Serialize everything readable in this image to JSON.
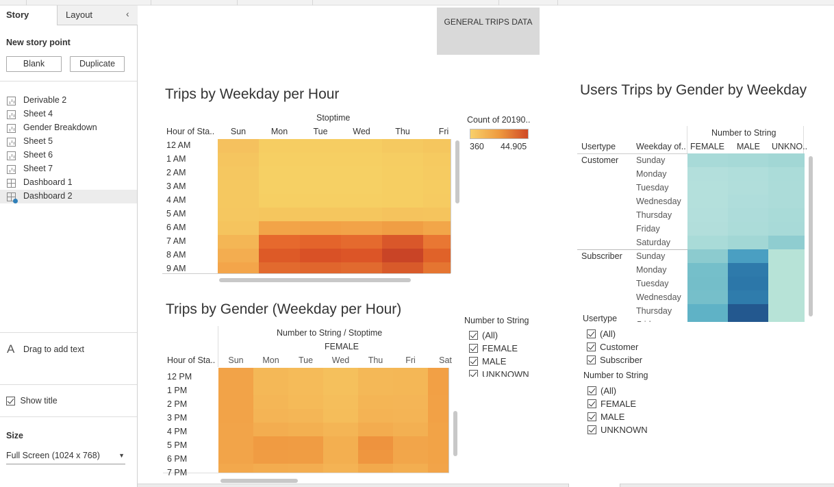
{
  "left_panel": {
    "tabs": {
      "story": "Story",
      "layout": "Layout"
    },
    "new_story_point": "New story point",
    "blank_button": "Blank",
    "duplicate_button": "Duplicate",
    "sheets": [
      {
        "label": "Derivable 2",
        "icon": "sheet-icon"
      },
      {
        "label": "Sheet 4",
        "icon": "sheet-icon"
      },
      {
        "label": "Gender Breakdown",
        "icon": "sheet-icon"
      },
      {
        "label": "Sheet 5",
        "icon": "sheet-icon"
      },
      {
        "label": "Sheet 6",
        "icon": "sheet-icon"
      },
      {
        "label": "Sheet 7",
        "icon": "sheet-icon"
      },
      {
        "label": "Dashboard 1",
        "icon": "dashboard-icon"
      },
      {
        "label": "Dashboard 2",
        "icon": "dashboard-selected-icon"
      }
    ],
    "drag_text": "Drag to add text",
    "show_title": "Show title",
    "size_label": "Size",
    "size_value": "Full Screen (1024 x 768)"
  },
  "dashboard": {
    "header_button": "GENERAL TRIPS DATA",
    "chart1": {
      "title": "Trips by Weekday per Hour",
      "column_header": "Stoptime",
      "row_header": "Hour of Sta..",
      "columns": [
        "Sun",
        "Mon",
        "Tue",
        "Wed",
        "Thu",
        "Fri"
      ],
      "rows": [
        "12 AM",
        "1 AM",
        "2 AM",
        "3 AM",
        "4 AM",
        "5 AM",
        "6 AM",
        "7 AM",
        "8 AM",
        "9 AM"
      ],
      "legend_title": "Count of 20190..",
      "legend_min": "360",
      "legend_max": "44.905",
      "colors": [
        [
          "#f5c15e",
          "#f6cd62",
          "#f6cd62",
          "#f6cd62",
          "#f5c960",
          "#f5c65e"
        ],
        [
          "#f5c55f",
          "#f6cf63",
          "#f6cf63",
          "#f6cf63",
          "#f6cd62",
          "#f6ca60"
        ],
        [
          "#f5c760",
          "#f6d064",
          "#f6d064",
          "#f6d064",
          "#f6ce62",
          "#f6cb61"
        ],
        [
          "#f5c860",
          "#f6d064",
          "#f6d064",
          "#f6d064",
          "#f6ce62",
          "#f6cc61"
        ],
        [
          "#f5c860",
          "#f6cf63",
          "#f6cf63",
          "#f6cf63",
          "#f6ce62",
          "#f6cb61"
        ],
        [
          "#f5c760",
          "#f5c65e",
          "#f5c65e",
          "#f5c65e",
          "#f5c35d",
          "#f5c45d"
        ],
        [
          "#f5c45e",
          "#f2a448",
          "#f2a146",
          "#f2a348",
          "#f09e44",
          "#f2a649"
        ],
        [
          "#f4b655",
          "#e6692d",
          "#e4642b",
          "#e56a2e",
          "#d9572a",
          "#e97733"
        ],
        [
          "#f3ad50",
          "#dd5a27",
          "#d95126",
          "#dc5527",
          "#c94426",
          "#e06229"
        ],
        [
          "#f3a54a",
          "#e26a2e",
          "#e0662d",
          "#e16a2f",
          "#d85a2a",
          "#e57531"
        ]
      ]
    },
    "chart2": {
      "title": "Trips by Gender (Weekday per Hour)",
      "column_header": "Number to String  /  Stoptime",
      "subheader": "FEMALE",
      "row_header": "Hour of Sta..",
      "columns": [
        "Sun",
        "Mon",
        "Tue",
        "Wed",
        "Thu",
        "Fri",
        "Sat"
      ],
      "rows": [
        "12 PM",
        "1 PM",
        "2 PM",
        "3 PM",
        "4 PM",
        "5 PM",
        "6 PM",
        "7 PM"
      ],
      "colors": [
        [
          "#f2a348",
          "#f4b857",
          "#f5bb59",
          "#f5c05c",
          "#f4b857",
          "#f4b756",
          "#f2a045"
        ],
        [
          "#f2a348",
          "#f4b857",
          "#f5bb59",
          "#f5c05c",
          "#f4b857",
          "#f4b756",
          "#f2a045"
        ],
        [
          "#f2a348",
          "#f4b656",
          "#f5ba58",
          "#f5be5b",
          "#f4b555",
          "#f4b556",
          "#f2a146"
        ],
        [
          "#f2a348",
          "#f4b455",
          "#f4b656",
          "#f5bd5a",
          "#f4b354",
          "#f4b455",
          "#f2a146"
        ],
        [
          "#f2a449",
          "#f3ad50",
          "#f3b051",
          "#f4b555",
          "#f3ac4f",
          "#f3b052",
          "#f2a347"
        ],
        [
          "#f2a449",
          "#f09b42",
          "#f09c43",
          "#f3af50",
          "#ee933e",
          "#f2a54a",
          "#f2a347"
        ],
        [
          "#f2a449",
          "#f09c43",
          "#f09d43",
          "#f3af50",
          "#ef963f",
          "#f2a64a",
          "#f2a347"
        ],
        [
          "#f3a84c",
          "#f3ac4f",
          "#f3ad50",
          "#f4b354",
          "#f2a94c",
          "#f3ae50",
          "#f2a449"
        ]
      ]
    },
    "filter_gender": {
      "title": "Number to String",
      "items": [
        "(All)",
        "FEMALE",
        "MALE",
        "UNKNOWN"
      ]
    },
    "chart3": {
      "title": "Users Trips by Gender by Weekday",
      "column_header": "Number to String",
      "usertype_header": "Usertype",
      "weekday_header": "Weekday of..",
      "columns": [
        "FEMALE",
        "MALE",
        "UNKNO.."
      ],
      "groups": [
        {
          "label": "Customer",
          "days": [
            "Sunday",
            "Monday",
            "Tuesday",
            "Wednesday",
            "Thursday",
            "Friday",
            "Saturday"
          ],
          "colors": [
            [
              "#a8dad8",
              "#a6d9d7",
              "#a2d7d5"
            ],
            [
              "#b3dfdc",
              "#b0dedb",
              "#abdcd9"
            ],
            [
              "#b4e0dc",
              "#b1dedb",
              "#acdcd9"
            ],
            [
              "#b4e0dc",
              "#afdddb",
              "#acdcd9"
            ],
            [
              "#b3dfdc",
              "#addcda",
              "#a9dbd8"
            ],
            [
              "#b2dedb",
              "#acdcd9",
              "#a8dad8"
            ],
            [
              "#a9dbd8",
              "#a2d7d5",
              "#8fcdd0"
            ]
          ]
        },
        {
          "label": "Subscriber",
          "days": [
            "Sunday",
            "Monday",
            "Tuesday",
            "Wednesday",
            "Thursday",
            "Friday"
          ],
          "colors": [
            [
              "#8ccbcf",
              "#4a9fc2",
              "#b7e3d7"
            ],
            [
              "#75bfca",
              "#2e7aab",
              "#b7e3d7"
            ],
            [
              "#74bec9",
              "#2c77a9",
              "#b7e3d7"
            ],
            [
              "#76bfca",
              "#2f7cac",
              "#b7e3d7"
            ],
            [
              "#5fb2c6",
              "#23588f",
              "#b7e3d7"
            ],
            [
              "#5fb2c6",
              "#23588f",
              "#b7e3d7"
            ]
          ]
        }
      ]
    },
    "filter_usertype": {
      "title": "Usertype",
      "items": [
        "(All)",
        "Customer",
        "Subscriber"
      ]
    },
    "filter_gender2": {
      "title": "Number to String",
      "items": [
        "(All)",
        "FEMALE",
        "MALE",
        "UNKNOWN"
      ]
    }
  }
}
